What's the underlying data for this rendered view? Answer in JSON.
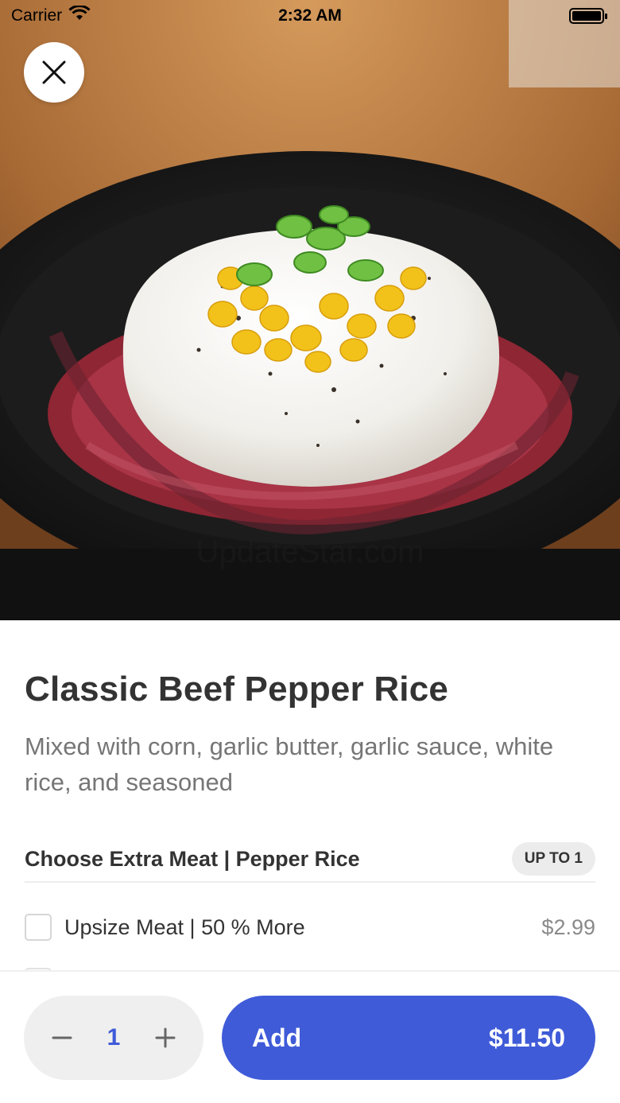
{
  "status_bar": {
    "carrier": "Carrier",
    "time": "2:32 AM"
  },
  "hero": {
    "watermark": "UpdateStar.com"
  },
  "item": {
    "title": "Classic Beef Pepper Rice",
    "description": "Mixed with corn, garlic butter, garlic sauce, white rice, and seasoned"
  },
  "option_group": {
    "title": "Choose Extra Meat | Pepper Rice",
    "badge": "UP TO 1",
    "options": [
      {
        "label": "Upsize Meat | 50 % More",
        "price": "$2.99",
        "checked": false
      }
    ]
  },
  "footer": {
    "quantity": "1",
    "add_label": "Add",
    "total": "$11.50"
  },
  "colors": {
    "accent": "#3f5bd8"
  }
}
